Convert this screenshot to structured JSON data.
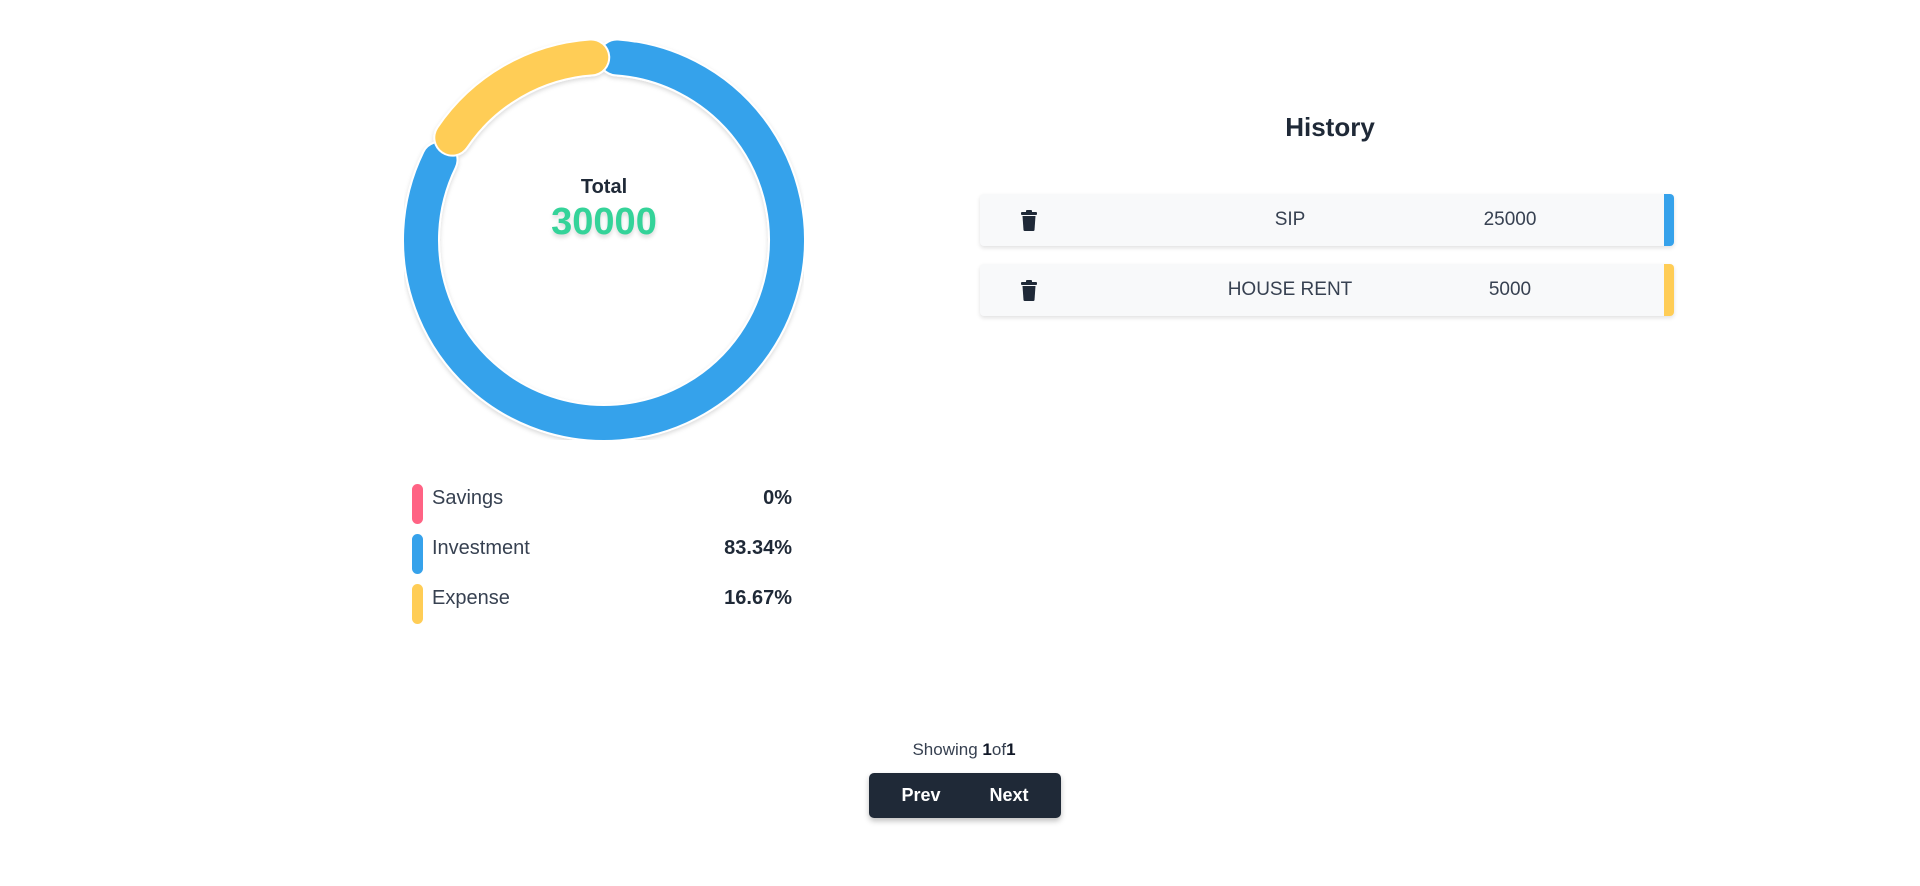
{
  "summary": {
    "total_label": "Total",
    "total_value": "30000"
  },
  "chart_data": {
    "type": "pie",
    "style": "donut",
    "categories": [
      "Savings",
      "Investment",
      "Expense"
    ],
    "values": [
      0,
      25000,
      5000
    ],
    "colors": [
      "#ff6384",
      "#36a2eb",
      "#ffcd56"
    ]
  },
  "legend": [
    {
      "label": "Savings",
      "value": "0%",
      "color": "#ff6384"
    },
    {
      "label": "Investment",
      "value": "83.34%",
      "color": "#36a2eb"
    },
    {
      "label": "Expense",
      "value": "16.67%",
      "color": "#ffcd56"
    }
  ],
  "history": {
    "title": "History",
    "items": [
      {
        "name": "SIP",
        "amount": "25000",
        "color": "#36a2eb",
        "icon": "trash-icon"
      },
      {
        "name": "HOUSE RENT",
        "amount": "5000",
        "color": "#ffcd56",
        "icon": "trash-icon"
      }
    ]
  },
  "pagination": {
    "showing_label": "Showing",
    "current": "1",
    "of_label": "of",
    "total": "1",
    "prev_label": "Prev",
    "next_label": "Next"
  }
}
